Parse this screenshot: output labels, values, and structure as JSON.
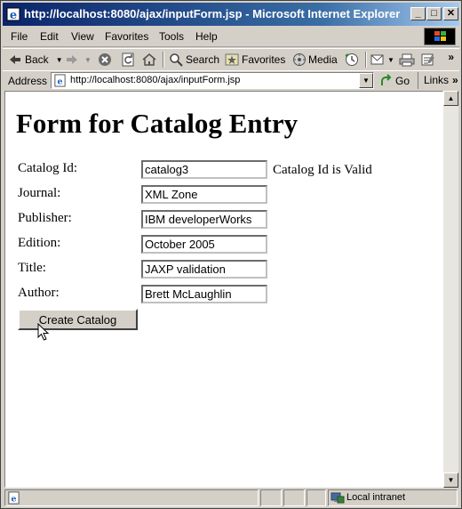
{
  "window": {
    "title": "http://localhost:8080/ajax/inputForm.jsp - Microsoft Internet Explorer"
  },
  "menu": {
    "items": [
      "File",
      "Edit",
      "View",
      "Favorites",
      "Tools",
      "Help"
    ]
  },
  "toolbar": {
    "back_label": "Back",
    "search_label": "Search",
    "favorites_label": "Favorites",
    "media_label": "Media"
  },
  "address": {
    "label": "Address",
    "url": "http://localhost:8080/ajax/inputForm.jsp",
    "go_label": "Go",
    "links_label": "Links"
  },
  "page": {
    "heading": "Form for Catalog Entry",
    "fields": [
      {
        "label": "Catalog Id:",
        "value": "catalog3"
      },
      {
        "label": "Journal:",
        "value": "XML Zone"
      },
      {
        "label": "Publisher:",
        "value": "IBM developerWorks"
      },
      {
        "label": "Edition:",
        "value": "October 2005"
      },
      {
        "label": "Title:",
        "value": "JAXP validation"
      },
      {
        "label": "Author:",
        "value": "Brett McLaughlin"
      }
    ],
    "validation_message": "Catalog Id is Valid",
    "submit_label": "Create Catalog"
  },
  "status": {
    "zone": "Local intranet"
  },
  "colors": {
    "titlebar_start": "#0a246a",
    "titlebar_end": "#a6caf0",
    "chrome": "#d4d0c8"
  }
}
